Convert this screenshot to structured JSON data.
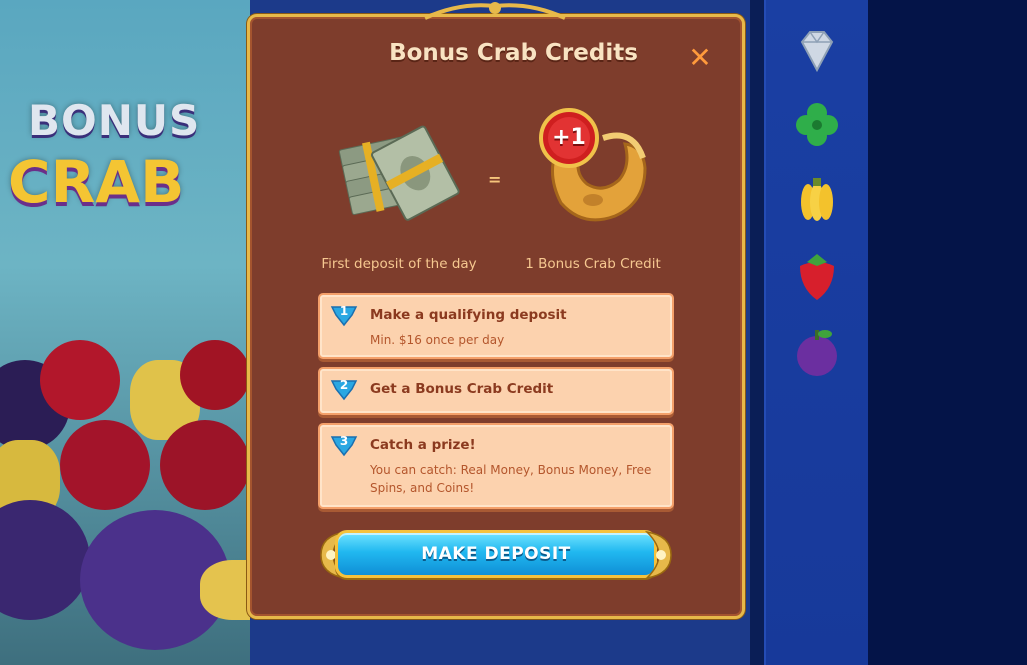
{
  "background": {
    "logo_top": "BONUS",
    "logo_bottom": "CRAB",
    "reel_symbols": [
      "diamond-icon",
      "clover-icon",
      "banana-icon",
      "strawberry-icon",
      "plum-icon"
    ]
  },
  "modal": {
    "title": "Bonus Crab Credits",
    "close_label": "✕",
    "equals": "=",
    "badge": "+1",
    "caption_left": "First deposit of the day",
    "caption_right": "1 Bonus Crab Credit",
    "steps": [
      {
        "number": "1",
        "title": "Make a qualifying deposit",
        "sub": "Min. $16 once per day"
      },
      {
        "number": "2",
        "title": "Get a Bonus Crab Credit",
        "sub": ""
      },
      {
        "number": "3",
        "title": "Catch a prize!",
        "sub": "You can catch: Real Money, Bonus Money, Free Spins, and Coins!"
      }
    ],
    "cta_label": "MAKE DEPOSIT"
  },
  "colors": {
    "modal_bg": "#7e3d2c",
    "title": "#f9e3c2",
    "close": "#ff9a3c",
    "step_bg": "#fcd2ae",
    "step_title": "#8b3a1f",
    "cta": "#21b8f0",
    "gold": "#e7b94a"
  }
}
